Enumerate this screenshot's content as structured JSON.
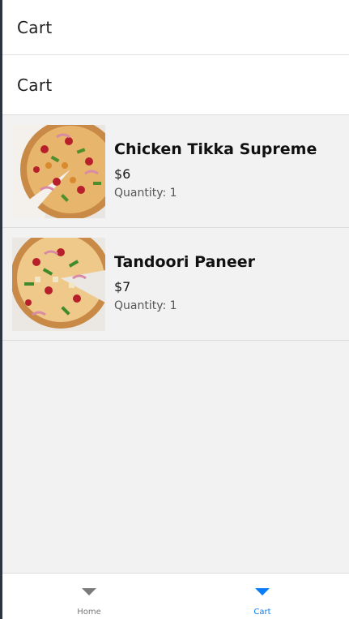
{
  "window": {
    "title": "Cart"
  },
  "page": {
    "header": "Cart"
  },
  "cart": {
    "items": [
      {
        "name": "Chicken Tikka Supreme",
        "price": "$6",
        "quantity_label": "Quantity: 1",
        "image_icon": "pizza-image"
      },
      {
        "name": "Tandoori Paneer",
        "price": "$7",
        "quantity_label": "Quantity: 1",
        "image_icon": "pizza-image"
      }
    ]
  },
  "tabs": [
    {
      "label": "Home",
      "active": false
    },
    {
      "label": "Cart",
      "active": true
    }
  ],
  "colors": {
    "accent": "#0a7cf5",
    "inactive": "#7a7a7a"
  }
}
